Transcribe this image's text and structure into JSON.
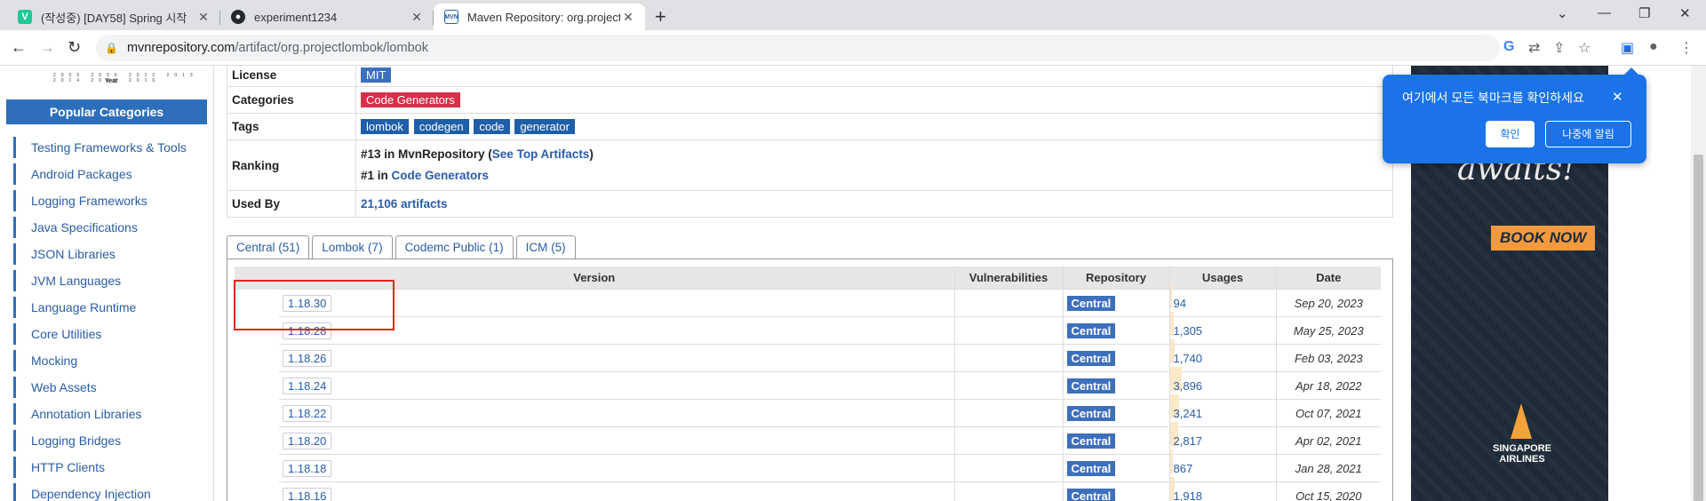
{
  "browser": {
    "tabs": [
      {
        "title": "(작성중) [DAY58] Spring 시작",
        "icon": "V"
      },
      {
        "title": "experiment1234",
        "icon": "github-icon"
      },
      {
        "title": "Maven Repository: org.projectlo",
        "icon": "MVN"
      }
    ],
    "url_host": "mvnrepository.com",
    "url_path": "/artifact/org.projectlombok/lombok"
  },
  "bookmark_popup": {
    "message": "여기에서 모든 북마크를 확인하세요",
    "ok_label": "확인",
    "later_label": "나중에 알림"
  },
  "sidebar": {
    "chart_years": "2005 2006 2012 2013 2014 2015 2016",
    "chart_axis": "Year",
    "popular_title": "Popular Categories",
    "categories": [
      {
        "label": "Testing Frameworks & Tools"
      },
      {
        "label": "Android Packages"
      },
      {
        "label": "Logging Frameworks"
      },
      {
        "label": "Java Specifications"
      },
      {
        "label": "JSON Libraries"
      },
      {
        "label": "JVM Languages"
      },
      {
        "label": "Language Runtime"
      },
      {
        "label": "Core Utilities"
      },
      {
        "label": "Mocking"
      },
      {
        "label": "Web Assets"
      },
      {
        "label": "Annotation Libraries"
      },
      {
        "label": "Logging Bridges"
      },
      {
        "label": "HTTP Clients"
      },
      {
        "label": "Dependency Injection"
      }
    ]
  },
  "info": {
    "license_label": "License",
    "license_value": "MIT",
    "categories_label": "Categories",
    "categories_value": "Code Generators",
    "tags_label": "Tags",
    "tags": [
      "lombok",
      "codegen",
      "code",
      "generator"
    ],
    "ranking_label": "Ranking",
    "ranking_1_prefix": "#13 in MvnRepository (",
    "ranking_1_link": "See Top Artifacts",
    "ranking_1_suffix": ")",
    "ranking_2_prefix": "#1 in",
    "ranking_2_link": "Code Generators",
    "usedby_label": "Used By",
    "usedby_value": "21,106 artifacts"
  },
  "version_tabs": [
    "Central (51)",
    "Lombok (7)",
    "Codemc Public (1)",
    "ICM (5)"
  ],
  "versions_table": {
    "headers": [
      "Version",
      "Vulnerabilities",
      "Repository",
      "Usages",
      "Date"
    ],
    "rows": [
      {
        "version": "1.18.30",
        "repo": "Central",
        "usages": "94",
        "usage_pct": 2,
        "date": "Sep 20, 2023"
      },
      {
        "version": "1.18.28",
        "repo": "Central",
        "usages": "1,305",
        "usage_pct": 4,
        "date": "May 25, 2023"
      },
      {
        "version": "1.18.26",
        "repo": "Central",
        "usages": "1,740",
        "usage_pct": 5,
        "date": "Feb 03, 2023"
      },
      {
        "version": "1.18.24",
        "repo": "Central",
        "usages": "3,896",
        "usage_pct": 11,
        "date": "Apr 18, 2022"
      },
      {
        "version": "1.18.22",
        "repo": "Central",
        "usages": "3,241",
        "usage_pct": 9,
        "date": "Oct 07, 2021"
      },
      {
        "version": "1.18.20",
        "repo": "Central",
        "usages": "2,817",
        "usage_pct": 8,
        "date": "Apr 02, 2021"
      },
      {
        "version": "1.18.18",
        "repo": "Central",
        "usages": "867",
        "usage_pct": 3,
        "date": "Jan 28, 2021"
      },
      {
        "version": "1.18.16",
        "repo": "Central",
        "usages": "1,918",
        "usage_pct": 5,
        "date": "Oct 15, 2020"
      }
    ]
  },
  "ad": {
    "headline": "awaits!",
    "cta": "BOOK NOW",
    "brand": "SINGAPORE AIRLINES"
  }
}
